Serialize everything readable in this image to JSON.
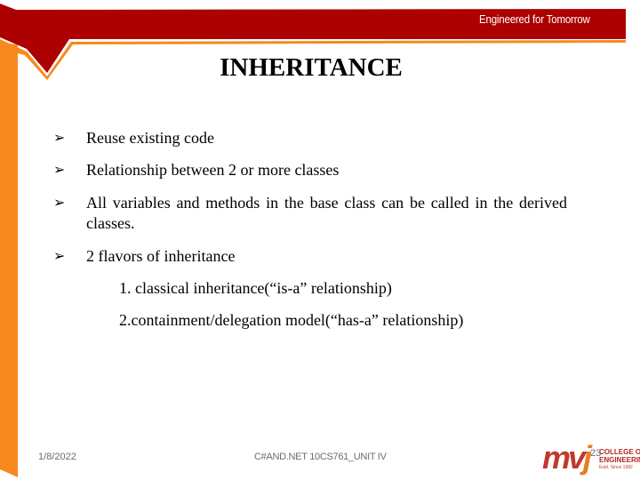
{
  "header": {
    "tagline": "Engineered for Tomorrow",
    "colors": {
      "banner_red": "#ad0000",
      "accent_orange": "#f7891e"
    }
  },
  "slide": {
    "title": "INHERITANCE",
    "bullet_icon": "arrow-bullet-icon",
    "bullets": [
      {
        "text": "Reuse existing code"
      },
      {
        "text": "Relationship between 2 or more classes"
      },
      {
        "text": "All variables and methods in the base class can be called in the derived classes."
      },
      {
        "text": "2 flavors of inheritance"
      }
    ],
    "sub_items": [
      {
        "text": "1. classical inheritance(“is-a” relationship)"
      },
      {
        "text": "2.containment/delegation model(“has-a” relationship)"
      }
    ]
  },
  "footer": {
    "date": "1/8/2022",
    "course": "C#AND.NET 10CS761_UNIT IV",
    "page_number": "23",
    "logo": {
      "mark": "mv",
      "mark_j": "j",
      "line1": "COLLEGE OF",
      "line2": "ENGINEERING",
      "line3": "Estd. Since 1982"
    }
  }
}
